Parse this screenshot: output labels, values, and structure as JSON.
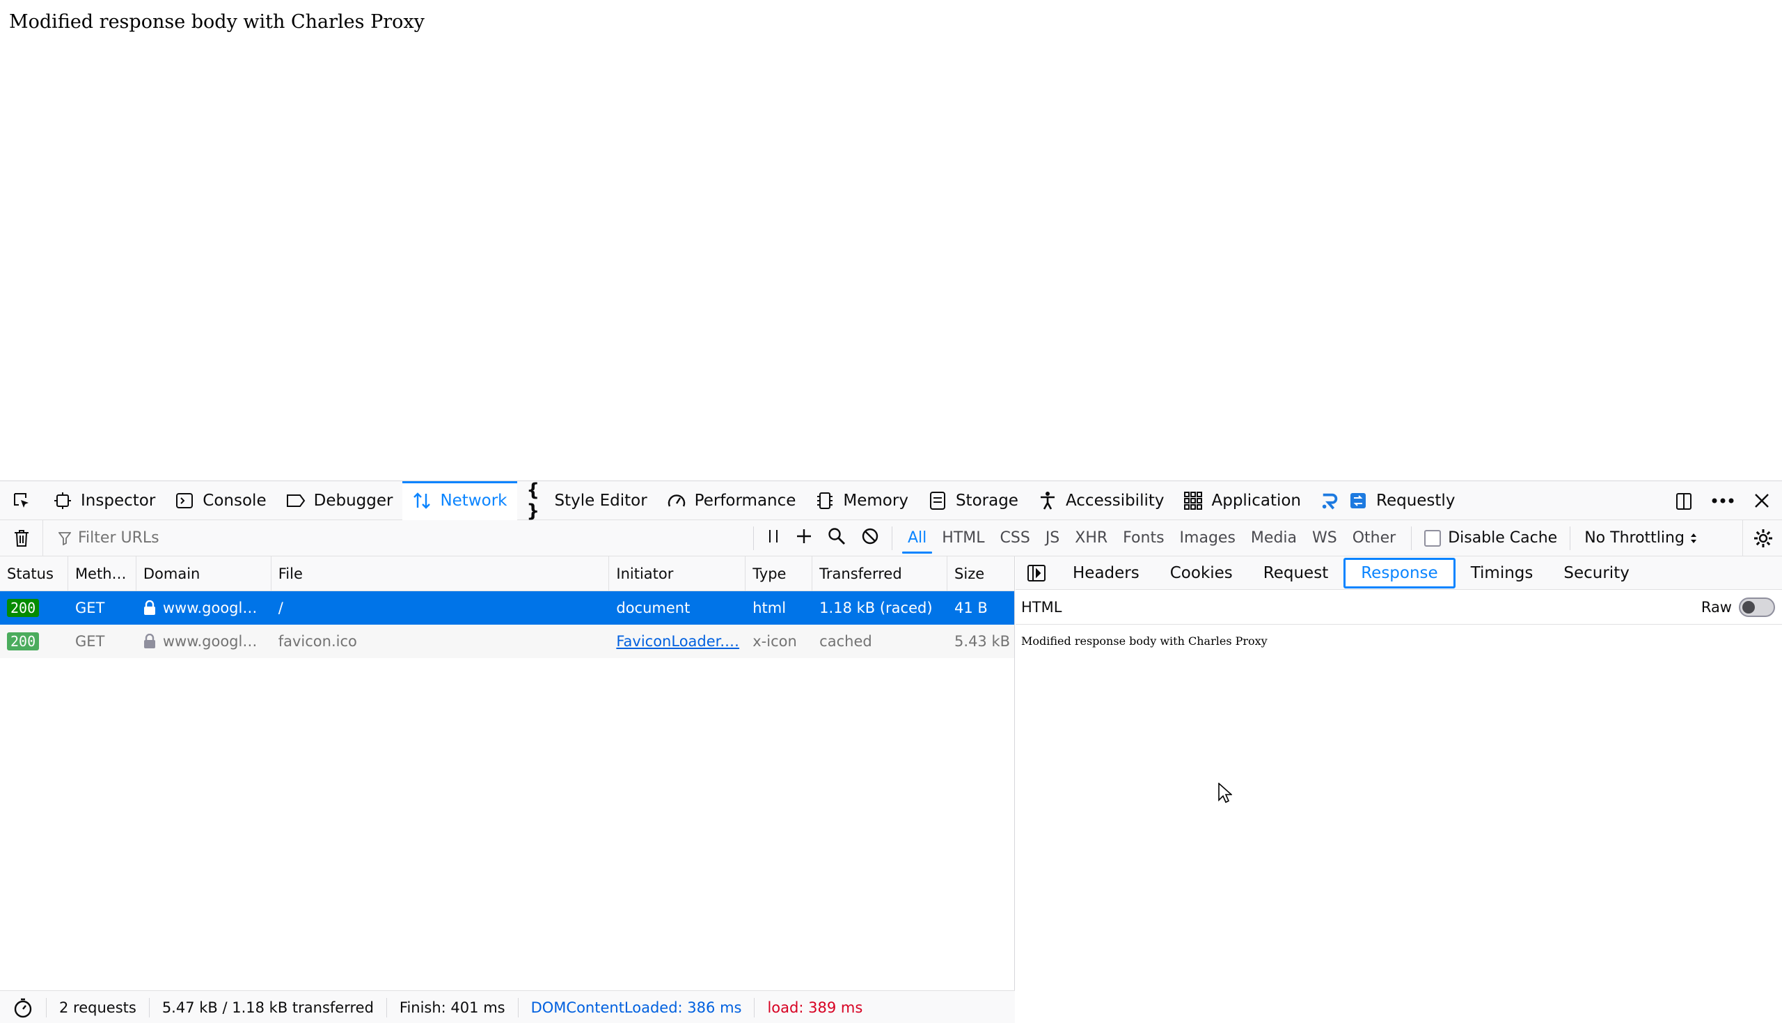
{
  "page": {
    "body_text": "Modified response body with Charles Proxy"
  },
  "toolbox": {
    "tabs": [
      {
        "label": "Inspector",
        "icon": "inspector-icon"
      },
      {
        "label": "Console",
        "icon": "console-icon"
      },
      {
        "label": "Debugger",
        "icon": "debugger-icon"
      },
      {
        "label": "Network",
        "icon": "network-icon",
        "selected": true
      },
      {
        "label": "Style Editor",
        "icon": "style-editor-icon"
      },
      {
        "label": "Performance",
        "icon": "performance-icon"
      },
      {
        "label": "Memory",
        "icon": "memory-icon"
      },
      {
        "label": "Storage",
        "icon": "storage-icon"
      },
      {
        "label": "Accessibility",
        "icon": "accessibility-icon"
      },
      {
        "label": "Application",
        "icon": "application-icon"
      },
      {
        "label": "Requestly",
        "icon": "requestly-icon"
      }
    ]
  },
  "filterbar": {
    "placeholder": "Filter URLs",
    "types": [
      "All",
      "HTML",
      "CSS",
      "JS",
      "XHR",
      "Fonts",
      "Images",
      "Media",
      "WS",
      "Other"
    ],
    "selected_type": "All",
    "disable_cache_label": "Disable Cache",
    "throttling": "No Throttling"
  },
  "table": {
    "columns": [
      "Status",
      "Meth…",
      "Domain",
      "File",
      "Initiator",
      "Type",
      "Transferred",
      "Size"
    ],
    "rows": [
      {
        "status": "200",
        "method": "GET",
        "domain": "www.googl…",
        "file": "/",
        "initiator": "document",
        "type": "html",
        "transferred": "1.18 kB (raced)",
        "size": "41 B"
      },
      {
        "status": "200",
        "method": "GET",
        "domain": "www.googl…",
        "file": "favicon.ico",
        "initiator": "FaviconLoader.…",
        "type": "x-icon",
        "transferred": "cached",
        "size": "5.43 kB"
      }
    ]
  },
  "statusbar": {
    "requests": "2 requests",
    "transferred": "5.47 kB / 1.18 kB transferred",
    "finish": "Finish: 401 ms",
    "dom_content_loaded": "DOMContentLoaded: 386 ms",
    "load": "load: 389 ms"
  },
  "details": {
    "tabs": [
      "Headers",
      "Cookies",
      "Request",
      "Response",
      "Timings",
      "Security"
    ],
    "selected_tab": "Response",
    "format_label": "HTML",
    "raw_label": "Raw",
    "raw_enabled": false,
    "response_body": "Modified response body with Charles Proxy"
  },
  "colors": {
    "accent": "#0a84ff",
    "selected_row": "#0074e8",
    "status_ok": "#058b00",
    "dom_content_loaded": "#0060df",
    "load": "#d70022"
  }
}
